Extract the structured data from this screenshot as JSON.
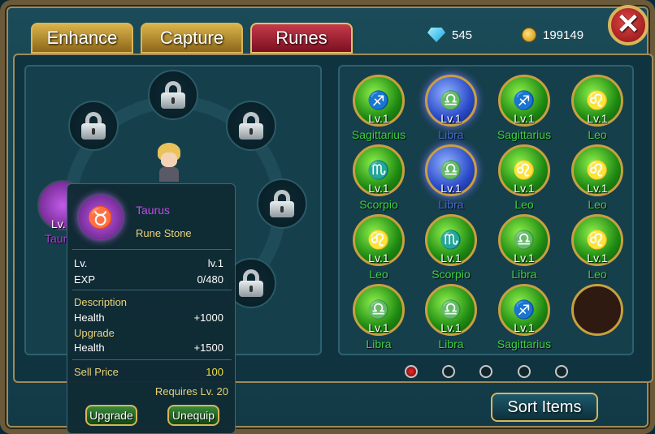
{
  "tabs": [
    "Enhance",
    "Capture",
    "Runes"
  ],
  "active_tab": "Runes",
  "currency": {
    "gems": "545",
    "gold": "199149"
  },
  "close_label": "✕",
  "equipped": {
    "level": "Lv.",
    "name": "Taur"
  },
  "tooltip": {
    "name": "Taurus",
    "type": "Rune Stone",
    "level_label": "Lv.",
    "level_value": "lv.1",
    "exp_label": "EXP",
    "exp_value": "0/480",
    "description_label": "Description",
    "desc_stat": "Health",
    "desc_value": "+1000",
    "upgrade_label": "Upgrade",
    "up_stat": "Health",
    "up_value": "+1500",
    "sell_label": "Sell Price",
    "sell_value": "100",
    "requires": "Requires Lv. 20",
    "upgrade_button": "Upgrade",
    "unequip_button": "Unequip"
  },
  "runes": [
    {
      "level": "Lv.1",
      "name": "Sagittarius",
      "color": "green",
      "glyph": "♐"
    },
    {
      "level": "Lv.1",
      "name": "Libra",
      "color": "blue",
      "glyph": "♎"
    },
    {
      "level": "Lv.1",
      "name": "Sagittarius",
      "color": "green",
      "glyph": "♐"
    },
    {
      "level": "Lv.1",
      "name": "Leo",
      "color": "green",
      "glyph": "♌"
    },
    {
      "level": "Lv.1",
      "name": "Scorpio",
      "color": "green",
      "glyph": "♏"
    },
    {
      "level": "Lv.1",
      "name": "Libra",
      "color": "blue",
      "glyph": "♎"
    },
    {
      "level": "Lv.1",
      "name": "Leo",
      "color": "green",
      "glyph": "♌"
    },
    {
      "level": "Lv.1",
      "name": "Leo",
      "color": "green",
      "glyph": "♌"
    },
    {
      "level": "Lv.1",
      "name": "Leo",
      "color": "green",
      "glyph": "♌"
    },
    {
      "level": "Lv.1",
      "name": "Scorpio",
      "color": "green",
      "glyph": "♏"
    },
    {
      "level": "Lv.1",
      "name": "Libra",
      "color": "green",
      "glyph": "♎"
    },
    {
      "level": "Lv.1",
      "name": "Leo",
      "color": "green",
      "glyph": "♌"
    },
    {
      "level": "Lv.1",
      "name": "Libra",
      "color": "green",
      "glyph": "♎"
    },
    {
      "level": "Lv.1",
      "name": "Libra",
      "color": "green",
      "glyph": "♎"
    },
    {
      "level": "Lv.1",
      "name": "Sagittarius",
      "color": "green",
      "glyph": "♐"
    }
  ],
  "colors": {
    "rune_green_text": "#3fd23f",
    "rune_blue_text": "#4a6acf"
  },
  "sort_button": "Sort Items"
}
